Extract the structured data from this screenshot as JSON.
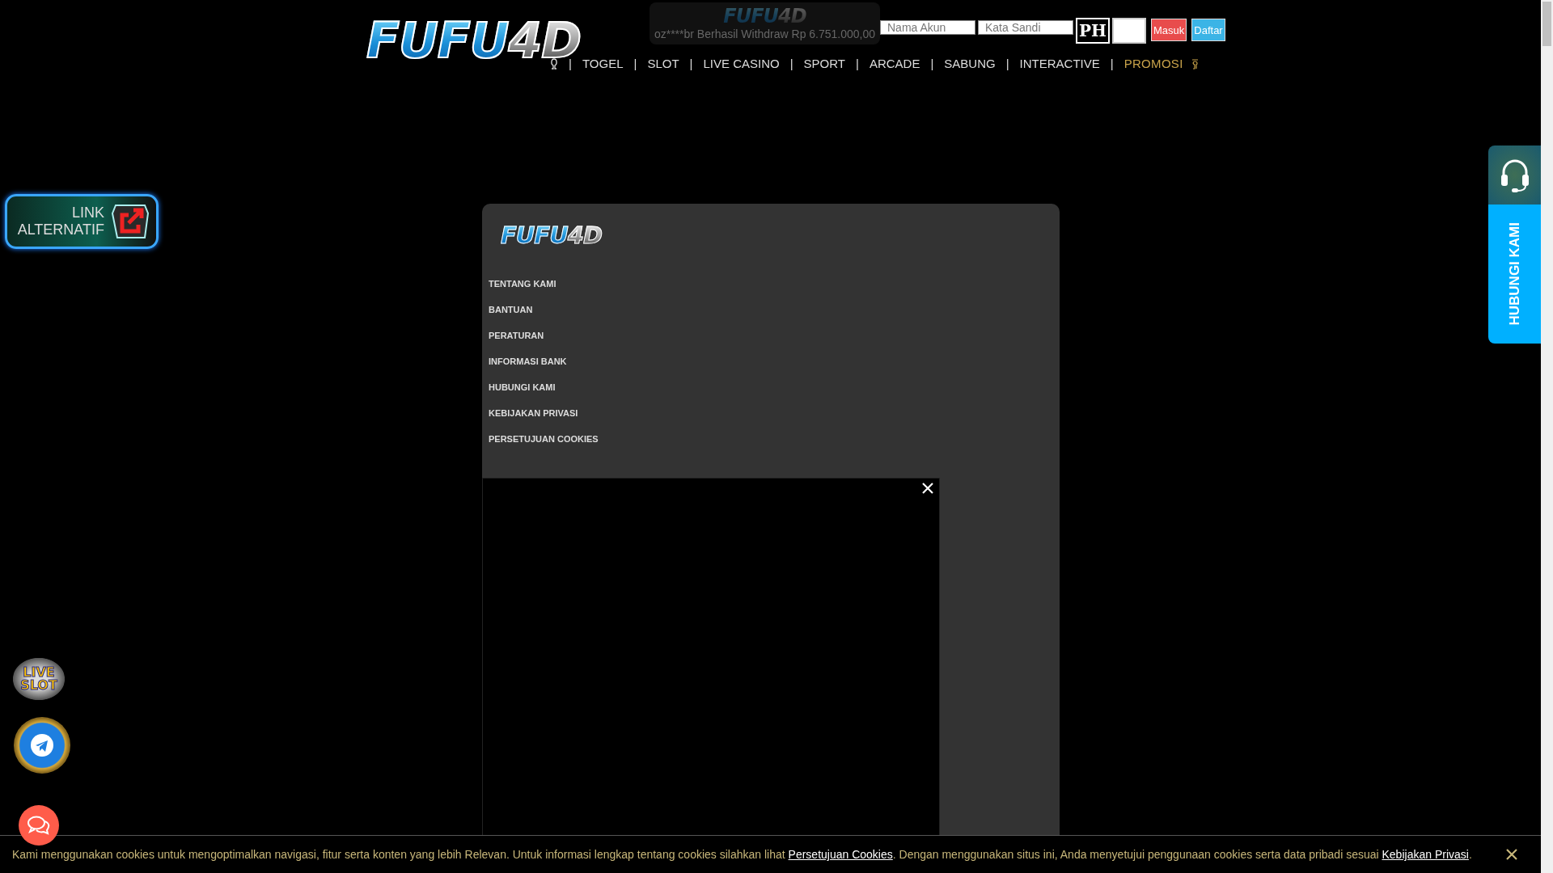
{
  "header": {
    "logo": {
      "part1": "FUFU",
      "part2": "4D"
    },
    "ticker": {
      "logo": {
        "part1": "FUFU",
        "part2": "4D"
      },
      "message": "oz****br Berhasil Withdraw Rp 6.751.000,00"
    },
    "login": {
      "username_placeholder": "Nama Akun",
      "password_placeholder": "Kata Sandi",
      "captcha": "PH",
      "login_button": "Masuk",
      "register_button": "Daftar"
    },
    "nav": [
      {
        "kind": "icon"
      },
      {
        "kind": "text",
        "separator": "|",
        "label": "TOGEL",
        "highlighted": false
      },
      {
        "kind": "text",
        "separator": "|",
        "label": "SLOT",
        "highlighted": false
      },
      {
        "kind": "text",
        "separator": "|",
        "label": "LIVE CASINO",
        "highlighted": false
      },
      {
        "kind": "text",
        "separator": "|",
        "label": "SPORT",
        "highlighted": false
      },
      {
        "kind": "text",
        "separator": "|",
        "label": "ARCADE",
        "highlighted": false
      },
      {
        "kind": "text",
        "separator": "|",
        "label": "SABUNG",
        "highlighted": false
      },
      {
        "kind": "text",
        "separator": "|",
        "label": "INTERACTIVE",
        "highlighted": false
      },
      {
        "kind": "text",
        "separator": "|",
        "label": "PROMOSI",
        "highlighted": true
      }
    ]
  },
  "link_alternatif": {
    "line1": "LINK",
    "line2": "ALTERNATIF"
  },
  "panel": {
    "logo": {
      "part1": "FUFU",
      "part2": "4D"
    },
    "menu": [
      "TENTANG KAMI",
      "BANTUAN",
      "PERATURAN",
      "INFORMASI BANK",
      "HUBUNGI KAMI",
      "KEBIJAKAN PRIVASI",
      "PERSETUJUAN COOKIES"
    ]
  },
  "contact_tab": {
    "label": "HUBUNGI KAMI"
  },
  "live_slot": {
    "line1": "LIVE",
    "line2": "SLOT"
  },
  "cookie_bar": {
    "text_before": "Kami menggunakan cookies untuk mengoptimalkan navigasi, fitur serta konten yang lebih Relevan. Untuk informasi lengkap tentang cookies silahkan lihat",
    "link1": "Persetujuan Cookies",
    "text_middle": ". Dengan menggunakan situs ini, Anda menyetujui penggunaan cookies serta data pribadi sesuai",
    "link2": "Kebijakan Privasi",
    "text_after": "."
  }
}
